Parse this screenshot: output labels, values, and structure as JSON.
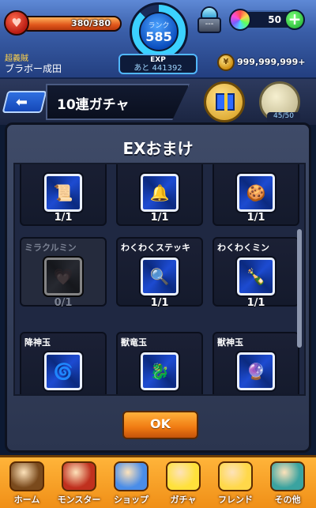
{
  "status": {
    "stamina_text": "380/380",
    "stamina_fraction": 1.0,
    "rank_label": "ランク",
    "rank_value": "585",
    "exp_label": "EXP",
    "exp_remaining": "あと 441392",
    "orb_count": "50",
    "gold": "999,999,999+",
    "player_title": "超義賊",
    "player_name": "ブラボー成田",
    "device_label": "---"
  },
  "header": {
    "title": "10連ガチャ",
    "mission_count": "45/50"
  },
  "modal": {
    "title": "EXおまけ",
    "items": [
      {
        "name": "",
        "count": "1/1",
        "icon": "scroll-icon",
        "glyph": "📜",
        "disabled": false
      },
      {
        "name": "",
        "count": "1/1",
        "icon": "bell-icon",
        "glyph": "🔔",
        "disabled": false
      },
      {
        "name": "",
        "count": "1/1",
        "icon": "cookie-icon",
        "glyph": "🍪",
        "disabled": false
      },
      {
        "name": "ミラクルミン",
        "count": "0/1",
        "icon": "potion-icon",
        "glyph": "💗",
        "disabled": true
      },
      {
        "name": "わくわくステッキ",
        "count": "1/1",
        "icon": "wand-icon",
        "glyph": "🔍",
        "disabled": false
      },
      {
        "name": "わくわくミン",
        "count": "1/1",
        "icon": "bottle-icon",
        "glyph": "🍾",
        "disabled": false
      },
      {
        "name": "降神玉",
        "count": "",
        "icon": "god-orb-icon",
        "glyph": "🌀",
        "disabled": false
      },
      {
        "name": "獣竜玉",
        "count": "",
        "icon": "dragon-orb-icon",
        "glyph": "🐉",
        "disabled": false
      },
      {
        "name": "獣神玉",
        "count": "",
        "icon": "beast-orb-icon",
        "glyph": "🔮",
        "disabled": false
      }
    ],
    "ok_label": "OK"
  },
  "nav": [
    {
      "label": "ホーム",
      "icon": "home-icon",
      "color": "#7a4a1c"
    },
    {
      "label": "モンスター",
      "icon": "monster-icon",
      "color": "#c0301e"
    },
    {
      "label": "ショップ",
      "icon": "orb-shop-icon",
      "color": "#4a8de8"
    },
    {
      "label": "ガチャ",
      "icon": "gacha-icon",
      "color": "#ffe13b"
    },
    {
      "label": "フレンド",
      "icon": "friend-icon",
      "color": "#ffd84a"
    },
    {
      "label": "その他",
      "icon": "other-icon",
      "color": "#3aa3a0"
    }
  ],
  "colors": {
    "accent": "#f07a12",
    "panel": "#2b354f",
    "frame_blue": "#1d4bd1"
  }
}
